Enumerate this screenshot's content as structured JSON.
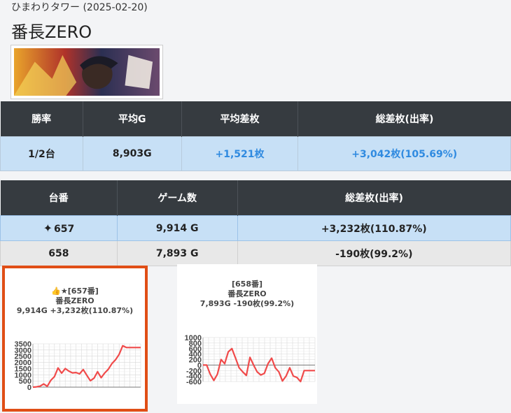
{
  "header": {
    "store": "ひまわりタワー (2025-02-20)",
    "title": "番長ZERO"
  },
  "summary": {
    "headers": [
      "勝率",
      "平均G",
      "平均差枚",
      "総差枚(出率)"
    ],
    "row": [
      "1/2台",
      "8,903G",
      "+1,521枚",
      "+3,042枚(105.69%)"
    ]
  },
  "machines": {
    "headers": [
      "台番",
      "ゲーム数",
      "総差枚(出率)"
    ],
    "rows": [
      {
        "number": "657",
        "games": "9,914 G",
        "diff": "+3,232枚(110.87%)"
      },
      {
        "number": "658",
        "games": "7,893 G",
        "diff": "-190枚(99.2%)"
      }
    ]
  },
  "cards": [
    {
      "line1": "👍★[657番]",
      "line2": "番長ZERO",
      "line3": "9,914G +3,232枚(110.87%)"
    },
    {
      "line1": "[658番]",
      "line2": "番長ZERO",
      "line3": "7,893G -190枚(99.2%)"
    }
  ],
  "colors": {
    "accent": "#e04e16",
    "series": "#f04a4a",
    "header_bg": "#363b40",
    "row_highlight": "#c7e0f6",
    "positive": "#2f8ae0"
  },
  "chart_data": [
    {
      "type": "line",
      "yticks": [
        0,
        500,
        1000,
        1500,
        2000,
        2500,
        3000,
        3500
      ],
      "ylim": [
        0,
        3500
      ],
      "values": [
        0,
        20,
        80,
        260,
        70,
        560,
        850,
        1550,
        1130,
        1500,
        1300,
        1150,
        1180,
        1070,
        1420,
        960,
        520,
        720,
        1250,
        760,
        1150,
        1450,
        1900,
        2220,
        2650,
        3340,
        3200,
        3200,
        3200,
        3200,
        3200
      ]
    },
    {
      "type": "line",
      "yticks": [
        -600,
        -400,
        -200,
        0,
        200,
        400,
        600,
        800,
        1000
      ],
      "ylim": [
        -600,
        1000
      ],
      "values": [
        0,
        0,
        -330,
        -560,
        -330,
        200,
        50,
        480,
        600,
        250,
        -100,
        -250,
        -380,
        280,
        0,
        -250,
        -360,
        -300,
        50,
        250,
        -100,
        -250,
        -580,
        -400,
        -100,
        -400,
        -450,
        -600,
        -200,
        -200,
        -200,
        -200
      ]
    }
  ]
}
